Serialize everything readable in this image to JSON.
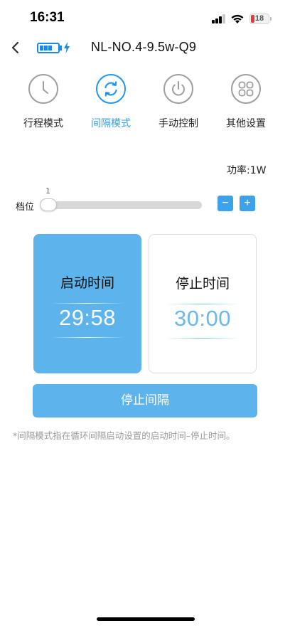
{
  "status_bar": {
    "time": "16:31",
    "battery": "18",
    "battery_color": "#e53935"
  },
  "header": {
    "title": "NL-NO.4-9.5w-Q9",
    "accent": "#1e88e5"
  },
  "tabs": [
    {
      "label": "行程模式",
      "icon": "clock-icon",
      "active": false
    },
    {
      "label": "间隔模式",
      "icon": "refresh-icon",
      "active": true
    },
    {
      "label": "手动控制",
      "icon": "power-icon",
      "active": false
    },
    {
      "label": "其他设置",
      "icon": "grid-icon",
      "active": false
    }
  ],
  "power_text": "功率:1W",
  "gear": {
    "label": "档位",
    "value": "1",
    "decrement": "−",
    "increment": "+"
  },
  "start_card": {
    "title": "启动时间",
    "time": "29:58"
  },
  "stop_card": {
    "title": "停止时间",
    "time": "30:00"
  },
  "action_button": "停止间隔",
  "note": "*间隔模式指在循环间隔启动设置的启动时间–停止时间。",
  "colors": {
    "primary": "#5db3ec",
    "active_tab": "#3aa0e6"
  }
}
